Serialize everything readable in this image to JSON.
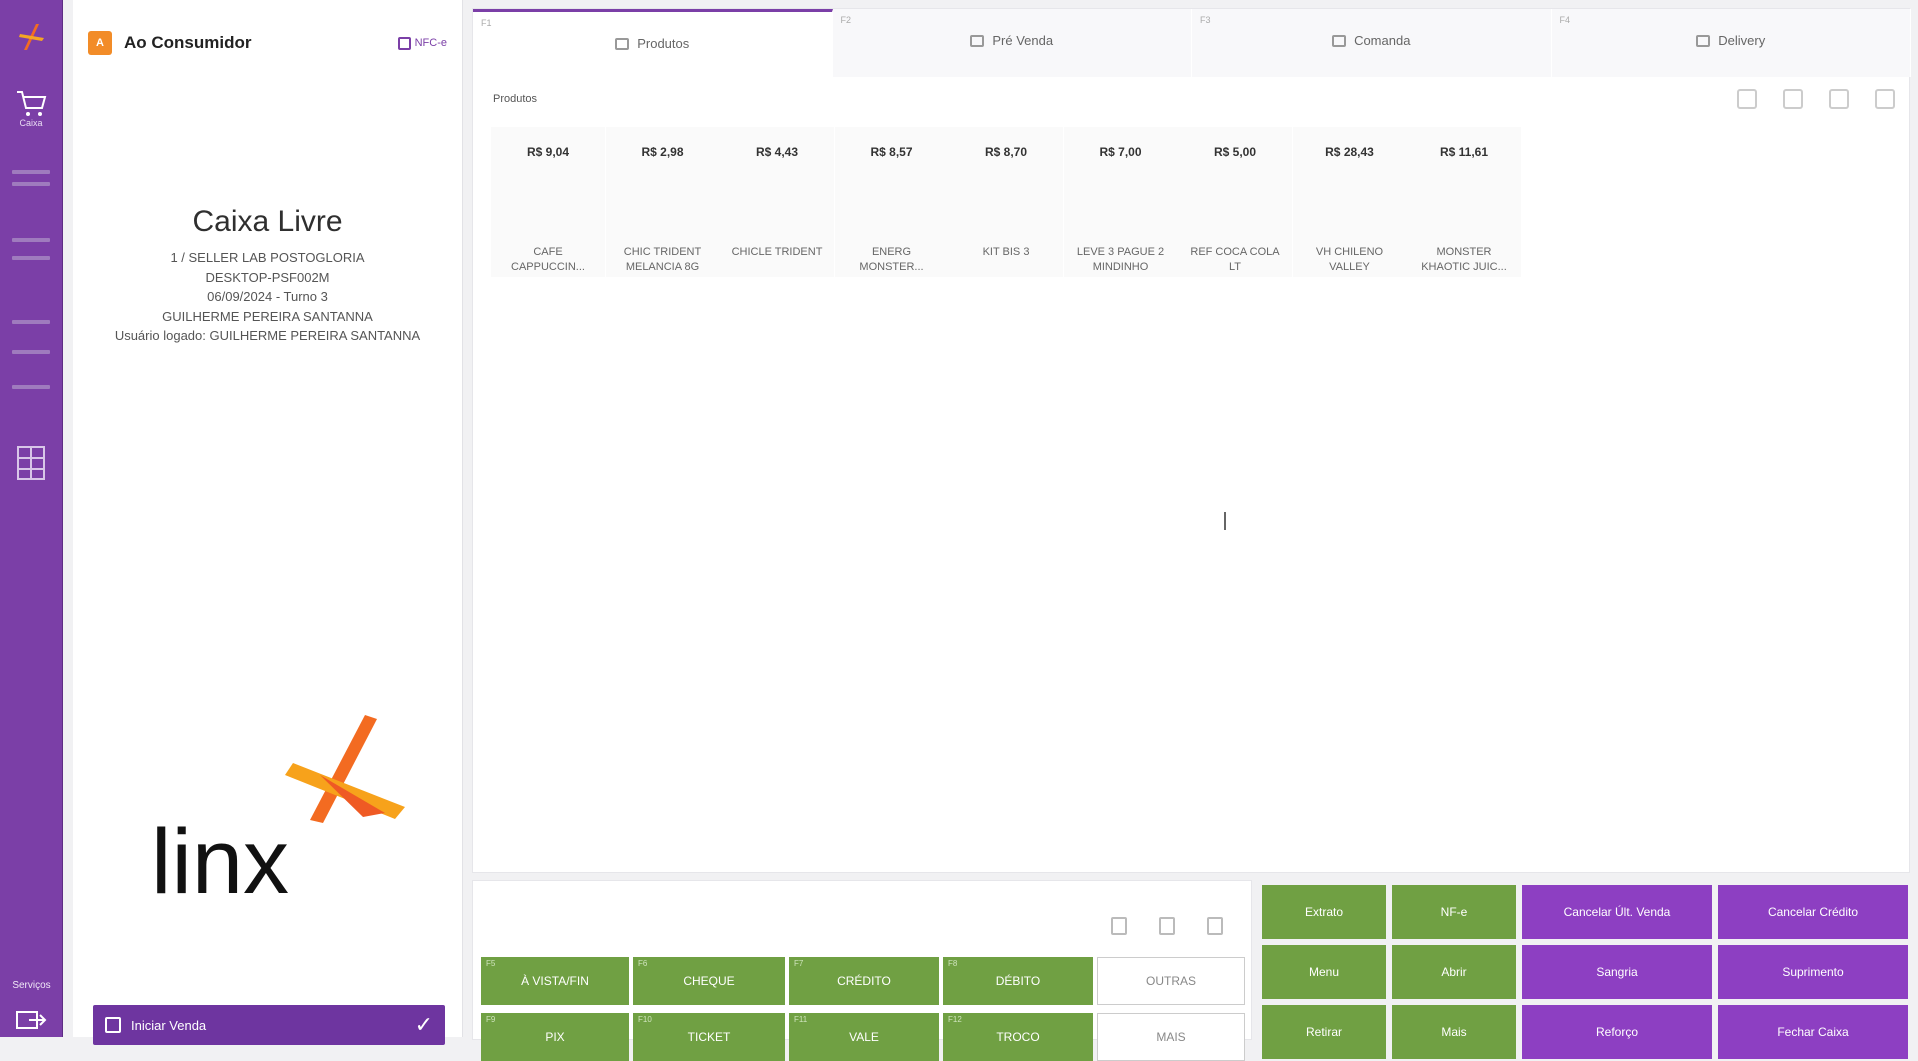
{
  "rail": {
    "cart_label": "Caixa",
    "services_label": "Serviços"
  },
  "customer": {
    "avatar_letter": "A",
    "name": "Ao Consumidor",
    "news_label": "NFC-e",
    "status_title": "Caixa Livre",
    "lines": [
      "1 / SELLER LAB POSTOGLORIA",
      "DESKTOP-PSF002M",
      "06/09/2024 - Turno 3",
      "GUILHERME PEREIRA SANTANNA",
      "Usuário logado: GUILHERME PEREIRA SANTANNA"
    ],
    "bottom_button": "Iniciar Venda"
  },
  "tabs": [
    {
      "hotkey": "F1",
      "label": "Produtos"
    },
    {
      "hotkey": "F2",
      "label": "Pré Venda"
    },
    {
      "hotkey": "F3",
      "label": "Comanda"
    },
    {
      "hotkey": "F4",
      "label": "Delivery"
    }
  ],
  "products_label": "Produtos",
  "products": [
    {
      "price": "R$ 9,04",
      "name": "CAFE CAPPUCCIN..."
    },
    {
      "price": "R$ 2,98",
      "name": "CHIC TRIDENT MELANCIA 8G"
    },
    {
      "price": "R$ 4,43",
      "name": "CHICLE TRIDENT"
    },
    {
      "price": "R$ 8,57",
      "name": "ENERG MONSTER..."
    },
    {
      "price": "R$ 8,70",
      "name": "KIT BIS 3"
    },
    {
      "price": "R$ 7,00",
      "name": "LEVE 3 PAGUE 2 MINDINHO"
    },
    {
      "price": "R$ 5,00",
      "name": "REF COCA COLA LT"
    },
    {
      "price": "R$ 28,43",
      "name": "VH CHILENO VALLEY"
    },
    {
      "price": "R$ 11,61",
      "name": "MONSTER KHAOTIC JUIC..."
    }
  ],
  "payments": [
    {
      "key": "F5",
      "label": "À VISTA/FIN"
    },
    {
      "key": "F6",
      "label": "CHEQUE"
    },
    {
      "key": "F7",
      "label": "CRÉDITO"
    },
    {
      "key": "F8",
      "label": "DÉBITO"
    },
    {
      "key": "",
      "label": "OUTRAS"
    },
    {
      "key": "F9",
      "label": "PIX"
    },
    {
      "key": "F10",
      "label": "TICKET"
    },
    {
      "key": "F11",
      "label": "VALE"
    },
    {
      "key": "F12",
      "label": "TROCO"
    },
    {
      "key": "",
      "label": "MAIS"
    }
  ],
  "actions": [
    {
      "label": "Extrato",
      "color": "#70a043"
    },
    {
      "label": "NF-e",
      "color": "#70a043"
    },
    {
      "label": "Cancelar Últ. Venda",
      "color": "#8d3fc2"
    },
    {
      "label": "Cancelar Crédito",
      "color": "#8d3fc2"
    },
    {
      "label": "Menu",
      "color": "#70a043"
    },
    {
      "label": "Abrir",
      "color": "#70a043"
    },
    {
      "label": "Sangria",
      "color": "#8d3fc2"
    },
    {
      "label": "Suprimento",
      "color": "#8d3fc2"
    },
    {
      "label": "Retirar",
      "color": "#70a043"
    },
    {
      "label": "Mais",
      "color": "#70a043"
    },
    {
      "label": "Reforço",
      "color": "#8d3fc2"
    },
    {
      "label": "Fechar Caixa",
      "color": "#8d3fc2"
    }
  ]
}
